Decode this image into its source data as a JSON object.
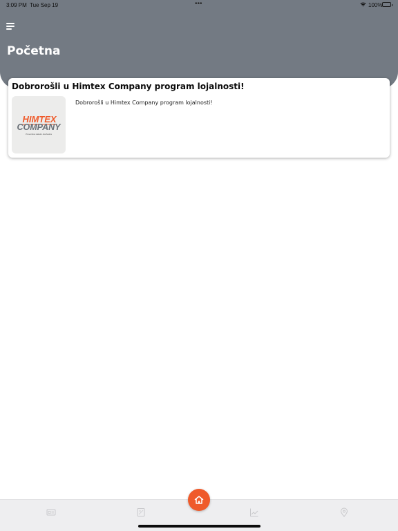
{
  "status_bar": {
    "time": "3:09 PM",
    "date": "Tue Sep 19",
    "dots": "•••",
    "battery_percent": "100%"
  },
  "header": {
    "title": "Početna",
    "background_color": "#737a83"
  },
  "card": {
    "title": "Dobrorošli u Himtex Company program lojalnosti!",
    "text": "Dobrorošli u Himtex Company program lojalnosti!",
    "logo": {
      "line1": "HIMTEX",
      "line2": "COMPANY",
      "tagline": "Preventiva daleko bezbedna",
      "accent_color": "#ef5a2a",
      "secondary_color": "#6a7077"
    }
  },
  "tab_bar": {
    "items": [
      {
        "icon": "card-icon"
      },
      {
        "icon": "document-icon"
      },
      {
        "icon": "home-icon",
        "active": true
      },
      {
        "icon": "chart-icon"
      },
      {
        "icon": "location-pin-icon"
      }
    ],
    "accent_color": "#ef5a2a"
  }
}
